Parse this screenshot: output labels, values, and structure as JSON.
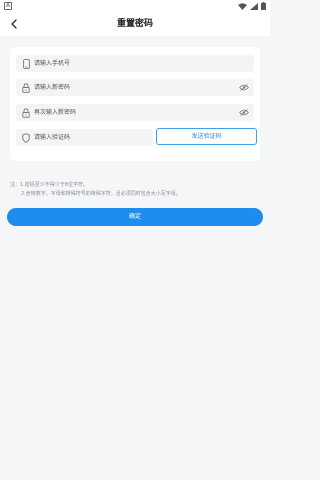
{
  "status_bar": {
    "left_badge": "A"
  },
  "header": {
    "title": "重置密码"
  },
  "form": {
    "phone": {
      "placeholder": "请输入手机号",
      "value": ""
    },
    "new_password": {
      "placeholder": "请输入新密码",
      "value": ""
    },
    "confirm_password": {
      "placeholder": "再次输入新密码",
      "value": ""
    },
    "code": {
      "placeholder": "请输入验证码",
      "value": ""
    },
    "send_code_label": "发送验证码"
  },
  "notes": {
    "line1": "注：1.密码至少不得少于8位字符。",
    "line2": "2.含特数字、字母和特殊符号的特殊字符，且必须同时包含大小写字母。"
  },
  "confirm_label": "确定",
  "colors": {
    "accent": "#1d8ef0",
    "background": "#f4f6f8",
    "field_bg": "#f3f4f6"
  }
}
